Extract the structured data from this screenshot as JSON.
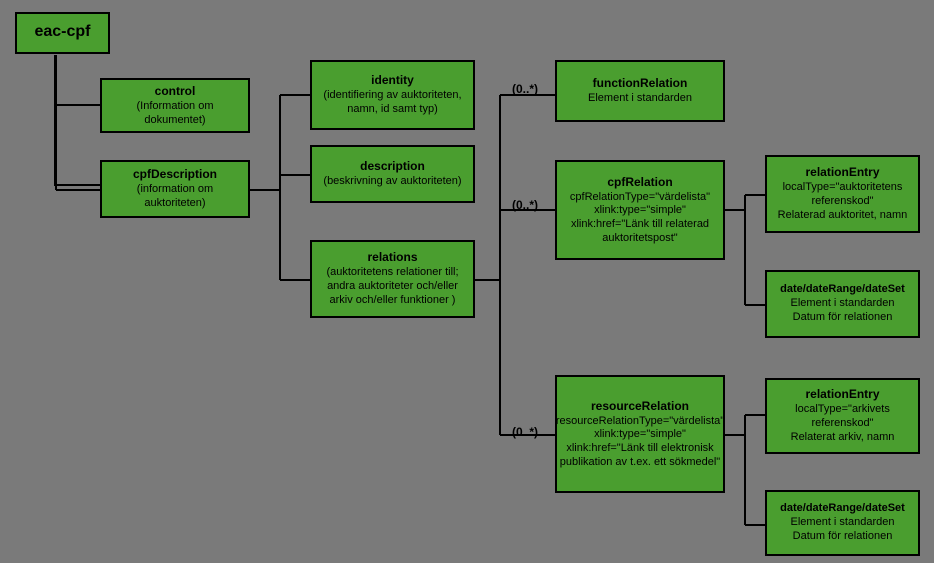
{
  "root": {
    "title": "eac-cpf"
  },
  "control": {
    "title": "control",
    "desc": "(Information om dokumentet)"
  },
  "cpfDescription": {
    "title": "cpfDescription",
    "desc": "(information om auktoriteten)"
  },
  "identity": {
    "title": "identity",
    "desc": "(identifiering av auktoriteten, namn, id samt typ)"
  },
  "description": {
    "title": "description",
    "desc": "(beskrivning av auktoriteten)"
  },
  "relations": {
    "title": "relations",
    "desc": "(auktoritetens relationer till; andra auktoriteter och/eller arkiv och/eller funktioner )"
  },
  "functionRelation": {
    "title": "functionRelation",
    "desc": "Element i standarden"
  },
  "cpfRelation": {
    "title": "cpfRelation",
    "desc": "cpfRelationType=\"värdelista\"\nxlink:type=\"simple\"\nxlink:href=\"Länk till relaterad auktoritetspost\""
  },
  "resourceRelation": {
    "title": "resourceRelation",
    "desc": "resourceRelationType=\"värdelista\"\nxlink:type=\"simple\"\nxlink:href=\"Länk till elektronisk publikation av t.ex. ett sökmedel\""
  },
  "relationEntry1": {
    "title": "relationEntry",
    "desc": "localType=\"auktoritetens referenskod\"\nRelaterad auktoritet, namn"
  },
  "dateSet1": {
    "title": "date/dateRange/dateSet",
    "desc": "Element i standarden\nDatum för relationen"
  },
  "relationEntry2": {
    "title": "relationEntry",
    "desc": "localType=\"arkivets referenskod\"\nRelaterat arkiv, namn"
  },
  "dateSet2": {
    "title": "date/dateRange/dateSet",
    "desc": "Element i standarden\nDatum för relationen"
  },
  "card": {
    "zeroStar": "(0..*)"
  },
  "chart_data": {
    "type": "tree",
    "root": "eac-cpf",
    "nodes": [
      {
        "id": "eac-cpf",
        "label": "eac-cpf",
        "children": [
          "control",
          "cpfDescription"
        ]
      },
      {
        "id": "control",
        "label": "control",
        "desc": "(Information om dokumentet)"
      },
      {
        "id": "cpfDescription",
        "label": "cpfDescription",
        "desc": "(information om auktoriteten)",
        "children": [
          "identity",
          "description",
          "relations"
        ]
      },
      {
        "id": "identity",
        "label": "identity",
        "desc": "(identifiering av auktoriteten, namn, id samt typ)"
      },
      {
        "id": "description",
        "label": "description",
        "desc": "(beskrivning av auktoriteten)"
      },
      {
        "id": "relations",
        "label": "relations",
        "desc": "(auktoritetens relationer till; andra auktoriteter och/eller arkiv och/eller funktioner )",
        "children": [
          "functionRelation",
          "cpfRelation",
          "resourceRelation"
        ]
      },
      {
        "id": "functionRelation",
        "label": "functionRelation",
        "desc": "Element i standarden",
        "cardinality": "(0..*)"
      },
      {
        "id": "cpfRelation",
        "label": "cpfRelation",
        "desc": "cpfRelationType=\"värdelista\"; xlink:type=\"simple\"; xlink:href=\"Länk till relaterad auktoritetspost\"",
        "cardinality": "(0..*)",
        "children": [
          "relationEntry1",
          "dateSet1"
        ]
      },
      {
        "id": "resourceRelation",
        "label": "resourceRelation",
        "desc": "resourceRelationType=\"värdelista\"; xlink:type=\"simple\"; xlink:href=\"Länk till elektronisk publikation av t.ex. ett sökmedel\"",
        "cardinality": "(0..*)",
        "children": [
          "relationEntry2",
          "dateSet2"
        ]
      },
      {
        "id": "relationEntry1",
        "label": "relationEntry",
        "desc": "localType=\"auktoritetens referenskod\"; Relaterad auktoritet, namn"
      },
      {
        "id": "dateSet1",
        "label": "date/dateRange/dateSet",
        "desc": "Element i standarden; Datum för relationen"
      },
      {
        "id": "relationEntry2",
        "label": "relationEntry",
        "desc": "localType=\"arkivets referenskod\"; Relaterat arkiv, namn"
      },
      {
        "id": "dateSet2",
        "label": "date/dateRange/dateSet",
        "desc": "Element i standarden; Datum för relationen"
      }
    ]
  }
}
